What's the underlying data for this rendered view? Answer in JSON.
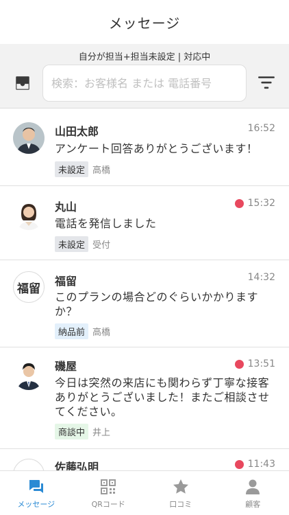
{
  "header": {
    "title": "メッセージ"
  },
  "filter": {
    "status_text": "自分が担当+担当未設定 | 対応中",
    "search_placeholder": "検索：お客様名 または 電話番号"
  },
  "conversations": [
    {
      "name": "山田太郎",
      "time": "16:52",
      "unread": false,
      "message": "アンケート回答ありがとうございます！",
      "status": "未設定",
      "assignee": "高橋"
    },
    {
      "name": "丸山",
      "time": "15:32",
      "unread": true,
      "message": "電話を発信しました",
      "status": "未設定",
      "assignee": "受付"
    },
    {
      "name": "福留",
      "avatar_text": "福留",
      "time": "14:32",
      "unread": false,
      "message": "このプランの場合どのぐらいかかりますか？",
      "status": "納品前",
      "assignee": "高橋"
    },
    {
      "name": "磯屋",
      "time": "13:51",
      "unread": true,
      "message": "今日は突然の来店にも関わらず丁寧な接客ありがとうございました！またご相談させてください。",
      "status": "商談中",
      "assignee": "井上"
    },
    {
      "name": "佐藤弘明",
      "time": "11:43",
      "unread": true
    }
  ],
  "tabs": [
    {
      "label": "メッセージ",
      "icon": "chat-bubbles-icon",
      "active": true
    },
    {
      "label": "QRコード",
      "icon": "qr-code-icon",
      "active": false
    },
    {
      "label": "口コミ",
      "icon": "star-icon",
      "active": false
    },
    {
      "label": "顧客",
      "icon": "person-icon",
      "active": false
    }
  ],
  "colors": {
    "accent": "#2a8ad4",
    "unread": "#e8485e"
  }
}
